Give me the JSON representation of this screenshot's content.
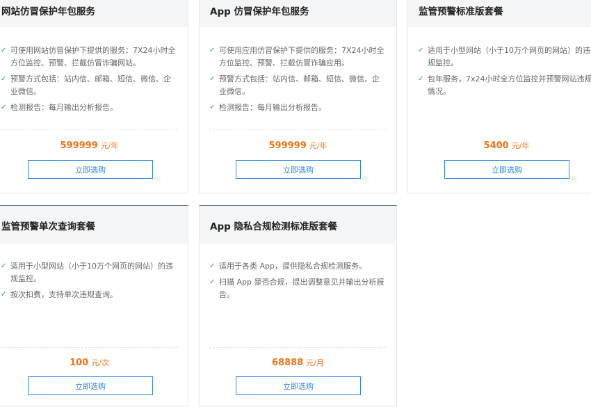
{
  "cards": [
    {
      "title": "网站仿冒保护年包服务",
      "features": [
        "可使用网站仿冒保护下提供的服务：7X24小时全方位监控、预警、拦截仿冒诈骗网站。",
        "预警方式包括：站内信、邮箱、短信、微信、企业微信。",
        "检测报告：每月输出分析报告。"
      ],
      "price": "599999",
      "unit": "元/年",
      "button": "立即选购"
    },
    {
      "title": "App 仿冒保护年包服务",
      "features": [
        "可使用应用仿冒保护下提供的服务：7X24小时全方位监控、预警、拦截仿冒诈骗应用。",
        "预警方式包括：站内信、邮箱、短信、微信、企业微信。",
        "检测报告：每月输出分析报告。"
      ],
      "price": "599999",
      "unit": "元/年",
      "button": "立即选购"
    },
    {
      "title": "监管预警标准版套餐",
      "features": [
        "适用于小型网站（小于10万个网页的网站）的违规监控。",
        "包年服务，7x24小时全方位监控并预警网站违规情况。"
      ],
      "price": "5400",
      "unit": "元/年",
      "button": "立即选购"
    },
    {
      "title": "监管预警单次查询套餐",
      "features": [
        "适用于小型网站（小于10万个网页的网站）的违规监控。",
        "按次扣费，支持单次违规查询。"
      ],
      "price": "100",
      "unit": "元/次",
      "button": "立即选购"
    },
    {
      "title": "App 隐私合规检测标准版套餐",
      "features": [
        "适用于各类 App，提供隐私合规检测服务。",
        "扫描 App 是否合规，提出调整意见并输出分析报告。"
      ],
      "price": "68888",
      "unit": "元/月",
      "button": "立即选购"
    }
  ],
  "icons": {
    "feature_bullet": "check-icon"
  },
  "colors": {
    "accent": "#2e86de",
    "price": "#f07417",
    "header_bg": "#f4f5f7"
  }
}
